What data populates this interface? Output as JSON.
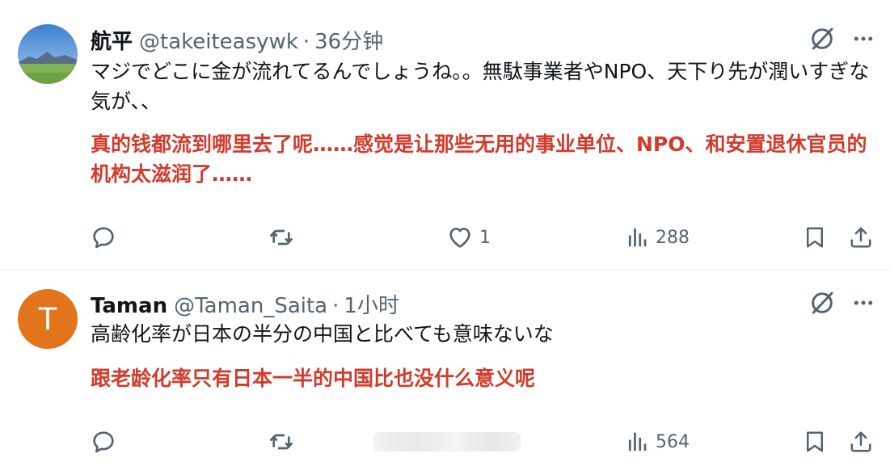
{
  "tweets": [
    {
      "name": "航平",
      "handle": "@takeiteasywk",
      "separator": "·",
      "time": "36分钟",
      "avatar_type": "photo-landscape",
      "text": "マジでどこに金が流れてるんでしょうね。。無駄事業者やNPO、天下り先が潤いすぎな気が、、",
      "translation": "真的钱都流到哪里去了呢……感觉是让那些无用的事业单位、NPO、和安置退休官员的机构太滋润了……",
      "likes": "1",
      "views": "288"
    },
    {
      "name": "Taman",
      "handle": "@Taman_Saita",
      "separator": "·",
      "time": "1小时",
      "avatar_letter": "T",
      "avatar_color": "#e2741b",
      "text": "高齢化率が日本の半分の中国と比べても意味ないな",
      "translation": "跟老龄化率只有日本一半的中国比也没什么意义呢",
      "views": "564"
    }
  ],
  "icons": {
    "grok": "grok-icon",
    "more": "more-icon",
    "reply": "reply-icon",
    "retweet": "retweet-icon",
    "like": "like-icon",
    "views": "views-icon",
    "bookmark": "bookmark-icon",
    "share": "share-icon"
  },
  "colors": {
    "translation": "#d23b2c",
    "secondary_text": "#536471",
    "primary_text": "#0f1419",
    "divider": "#eff3f4"
  }
}
